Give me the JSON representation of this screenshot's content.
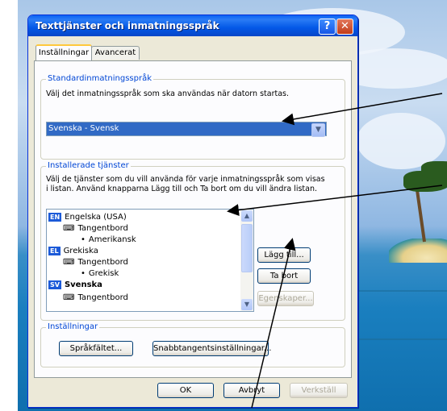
{
  "window": {
    "title": "Texttjänster och inmatningsspråk",
    "help_label": "?",
    "close_label": "✕"
  },
  "tabs": [
    {
      "label": "Inställningar",
      "active": true
    },
    {
      "label": "Avancerat",
      "active": false
    }
  ],
  "default_language": {
    "legend": "Standardinmatningsspråk",
    "description": "Välj det inmatningsspråk som ska användas när datorn startas.",
    "selected": "Svenska - Svensk"
  },
  "installed_services": {
    "legend": "Installerade tjänster",
    "description_line1": "Välj de tjänster som du vill använda för varje inmatningsspråk som visas",
    "description_line2": "i listan. Använd knapparna Lägg till och Ta bort om du vill ändra listan.",
    "items": [
      {
        "badge": "EN",
        "label": "Engelska (USA)"
      },
      {
        "label": "Tangentbord"
      },
      {
        "label": "Amerikansk"
      },
      {
        "badge": "EL",
        "label": "Grekiska"
      },
      {
        "label": "Tangentbord"
      },
      {
        "label": "Grekisk"
      },
      {
        "badge": "SV",
        "label": "Svenska"
      },
      {
        "label": "Tangentbord"
      }
    ],
    "buttons": {
      "add": "Lägg till...",
      "remove": "Ta bort",
      "properties": "Egenskaper..."
    }
  },
  "settings": {
    "legend": "Inställningar",
    "language_bar": "Språkfältet...",
    "hotkeys": "Snabbtangentsinställningar..."
  },
  "footer": {
    "ok": "OK",
    "cancel": "Avbryt",
    "apply": "Verkställ"
  },
  "icons": {
    "keyboard": "keyboard-icon",
    "bullet": "•"
  }
}
